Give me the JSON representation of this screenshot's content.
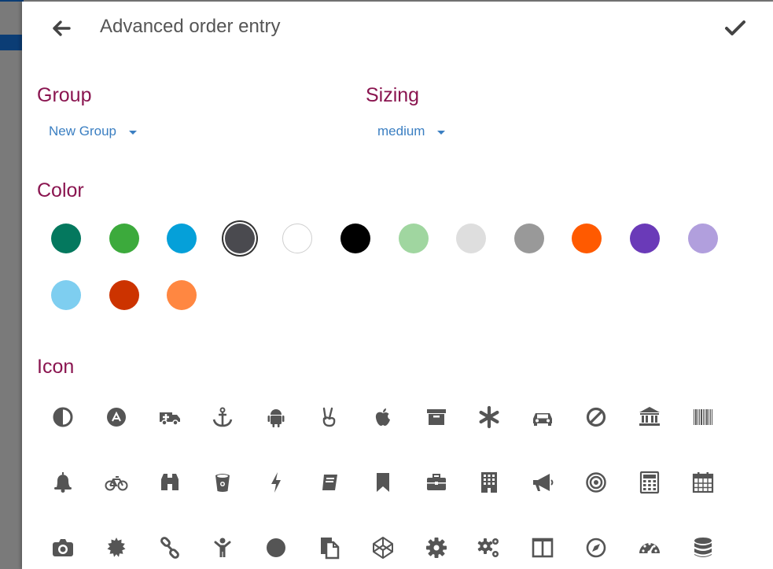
{
  "header": {
    "title": "Advanced order entry",
    "back_icon": "arrow-left-icon",
    "confirm_icon": "check-icon"
  },
  "group": {
    "label": "Group",
    "value": "New Group"
  },
  "sizing": {
    "label": "Sizing",
    "value": "medium"
  },
  "color": {
    "label": "Color",
    "selected": "#4a4a4f",
    "swatches": [
      "#04785e",
      "#3caa3c",
      "#05a0d9",
      "#4a4a4f",
      "#ffffff",
      "#000000",
      "#a0d6a0",
      "#dedede",
      "#999999",
      "#ff5a00",
      "#6a3ab8",
      "#b19fdd",
      "#7ecef0",
      "#cc3300",
      "#ff8741"
    ]
  },
  "icon": {
    "label": "Icon",
    "items": [
      "adjust-icon",
      "angellist-icon",
      "ambulance-icon",
      "anchor-icon",
      "android-icon",
      "peace-hand-icon",
      "apple-icon",
      "archive-icon",
      "asterisk-icon",
      "car-icon",
      "ban-icon",
      "bank-icon",
      "barcode-icon",
      "bell-icon",
      "bicycle-icon",
      "binoculars-icon",
      "bitbucket-icon",
      "bolt-icon",
      "book-icon",
      "bookmark-icon",
      "briefcase-icon",
      "building-icon",
      "bullhorn-icon",
      "bullseye-icon",
      "calculator-icon",
      "calendar-icon",
      "camera-icon",
      "certificate-icon",
      "chain-icon",
      "child-icon",
      "circle-icon",
      "clone-icon",
      "codepen-icon",
      "cog-icon",
      "cogs-icon",
      "columns-icon",
      "compass-icon",
      "dashboard-icon",
      "database-icon"
    ]
  }
}
